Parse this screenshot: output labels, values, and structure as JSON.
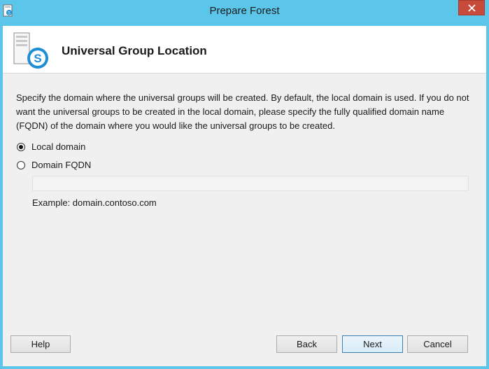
{
  "window": {
    "title": "Prepare Forest"
  },
  "header": {
    "title": "Universal Group Location"
  },
  "description": "Specify the domain where the universal groups will be created. By default, the local domain is used. If you do not want the universal groups to be created in the local domain, please specify the fully qualified domain name (FQDN) of the domain where you would like the universal groups to be created.",
  "options": {
    "local_domain": {
      "label": "Local domain",
      "selected": true
    },
    "domain_fqdn": {
      "label": "Domain FQDN",
      "selected": false
    }
  },
  "fqdn_input": {
    "value": "",
    "placeholder": ""
  },
  "example": "Example: domain.contoso.com",
  "buttons": {
    "help": "Help",
    "back": "Back",
    "next": "Next",
    "cancel": "Cancel"
  },
  "colors": {
    "frame": "#5bc6ea",
    "close": "#c74a3b",
    "client": "#f0f0f0"
  }
}
